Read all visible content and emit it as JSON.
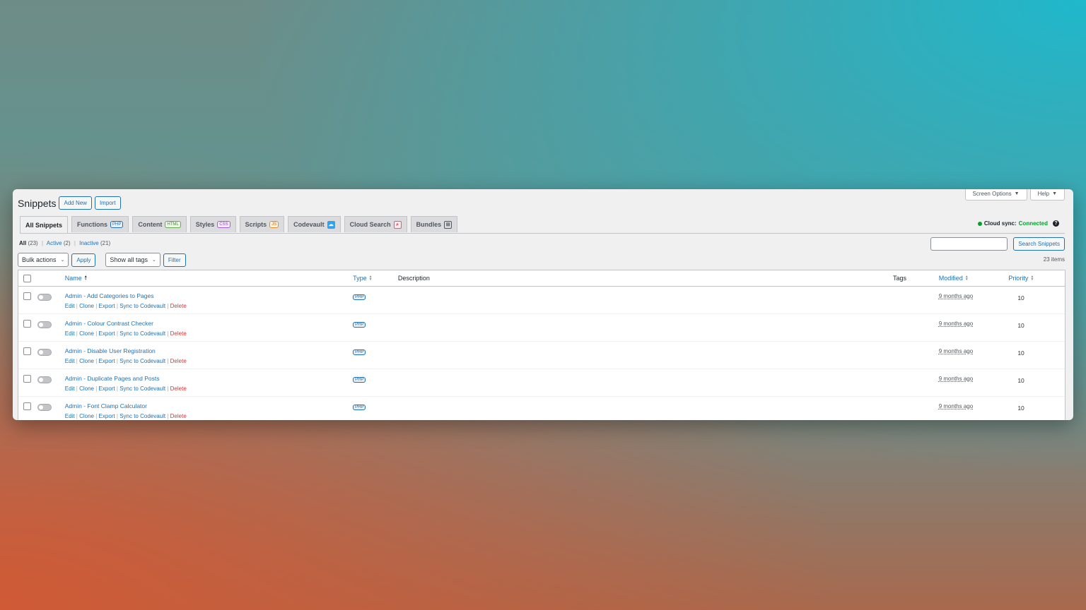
{
  "window": {
    "title": "Snippets",
    "add_new": "Add New",
    "import": "Import",
    "screen_options": "Screen Options",
    "help": "Help"
  },
  "tabs": [
    {
      "label": "All Snippets",
      "badge": "",
      "active": true
    },
    {
      "label": "Functions",
      "badge": "PHP"
    },
    {
      "label": "Content",
      "badge": "HTML"
    },
    {
      "label": "Styles",
      "badge": "CSS"
    },
    {
      "label": "Scripts",
      "badge": "JS"
    },
    {
      "label": "Codevault",
      "icon": "cloud-icon"
    },
    {
      "label": "Cloud Search",
      "icon": "search-icon"
    },
    {
      "label": "Bundles",
      "icon": "grid-icon"
    }
  ],
  "cloud_sync": {
    "label": "Cloud sync:",
    "status": "Connected",
    "status_color": "#00a32a"
  },
  "views": {
    "all": "All",
    "all_count": "(23)",
    "active": "Active",
    "active_count": "(2)",
    "inactive": "Inactive",
    "inactive_count": "(21)"
  },
  "search": {
    "button": "Search Snippets",
    "value": ""
  },
  "toolbar": {
    "bulk_actions": "Bulk actions",
    "apply": "Apply",
    "tags_filter": "Show all tags",
    "filter": "Filter",
    "items_count": "23 items"
  },
  "columns": {
    "name": "Name",
    "type": "Type",
    "description": "Description",
    "tags": "Tags",
    "modified": "Modified",
    "priority": "Priority"
  },
  "row_actions": {
    "edit": "Edit",
    "clone": "Clone",
    "export": "Export",
    "sync": "Sync to Codevault",
    "delete": "Delete"
  },
  "rows": [
    {
      "name": "Admin - Add Categories to Pages",
      "type": "PHP",
      "modified": "9 months ago",
      "priority": "10"
    },
    {
      "name": "Admin - Colour Contrast Checker",
      "type": "PHP",
      "modified": "9 months ago",
      "priority": "10"
    },
    {
      "name": "Admin - Disable User Registration",
      "type": "PHP",
      "modified": "9 months ago",
      "priority": "10"
    },
    {
      "name": "Admin - Duplicate Pages and Posts",
      "type": "PHP",
      "modified": "9 months ago",
      "priority": "10"
    },
    {
      "name": "Admin - Font Clamp Calculator",
      "type": "PHP",
      "modified": "9 months ago",
      "priority": "10"
    }
  ],
  "colors": {
    "accent": "#2271b1",
    "delete": "#d63638"
  }
}
